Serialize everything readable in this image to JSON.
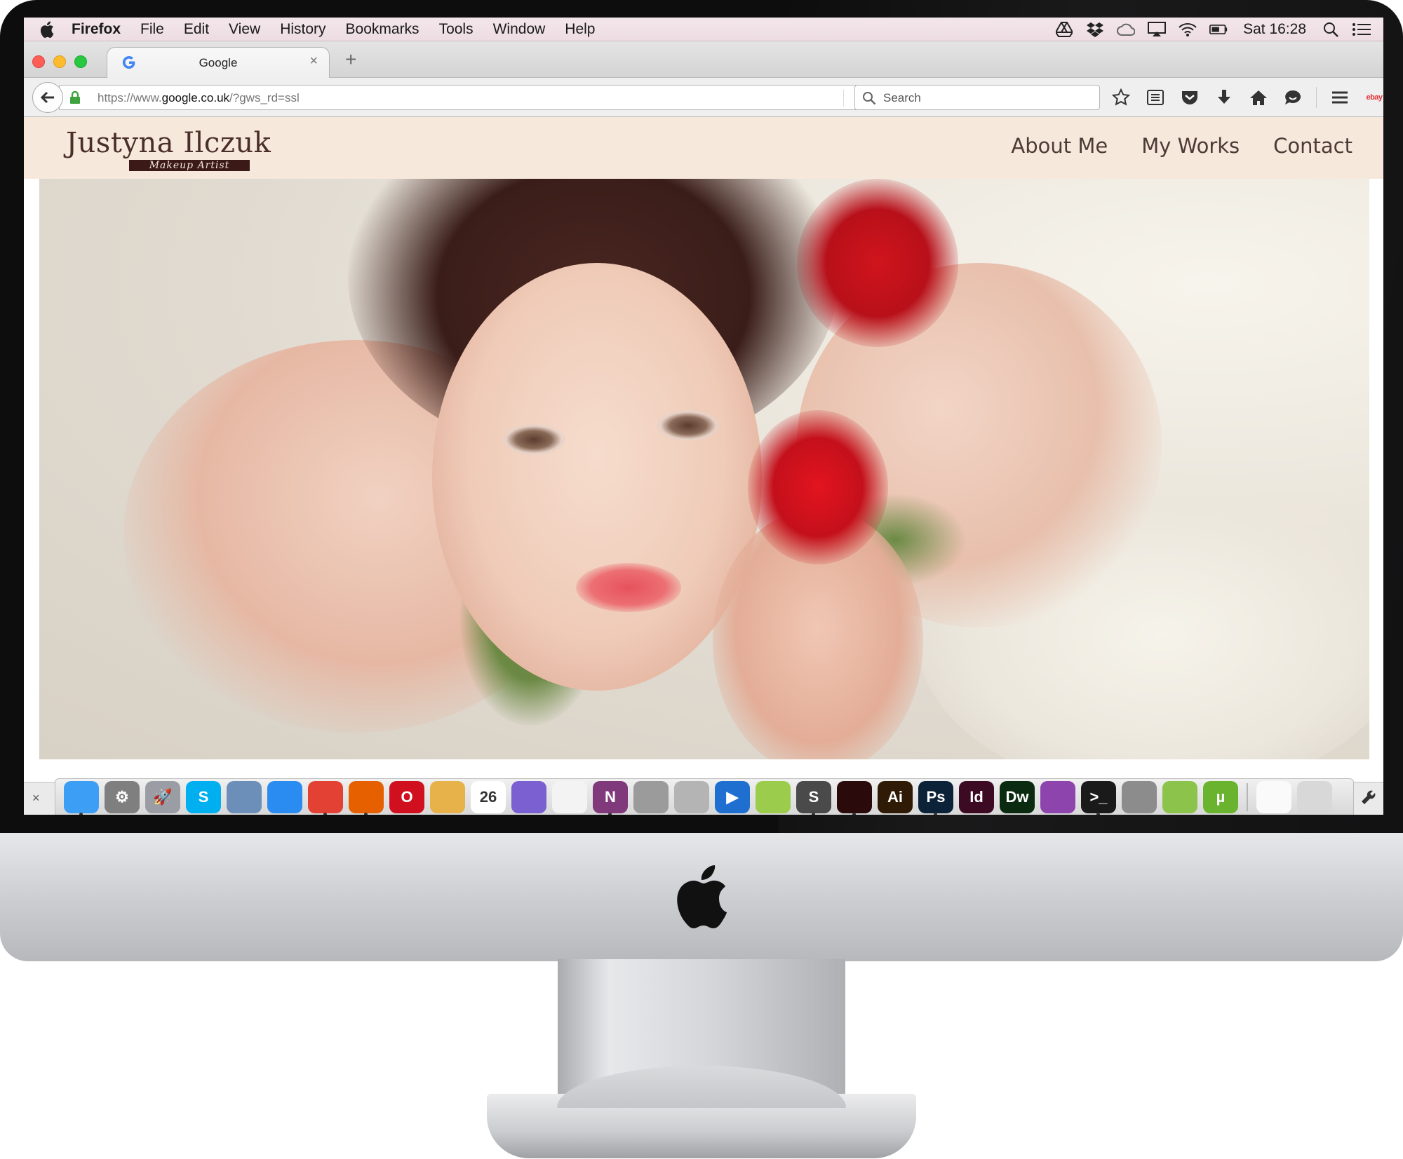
{
  "menubar": {
    "app_name": "Firefox",
    "menus": [
      "File",
      "Edit",
      "View",
      "History",
      "Bookmarks",
      "Tools",
      "Window",
      "Help"
    ],
    "clock": "Sat 16:28"
  },
  "browser": {
    "tab_title": "Google",
    "tab_close": "×",
    "new_tab": "+",
    "url_prefix": "https://www.",
    "url_host": "google.co.uk",
    "url_suffix": "/?gws_rd=ssl",
    "search_placeholder": "Search",
    "ebay": "ebay"
  },
  "site": {
    "logo_name": "Justyna Ilczuk",
    "logo_tagline": "Makeup Artist",
    "nav": [
      "About Me",
      "My Works",
      "Contact"
    ],
    "colors": {
      "header_bg": "#f7e8dc",
      "nav_text": "#4d3a35",
      "tagline_bg": "#3a1916"
    }
  },
  "dock": {
    "close": "×",
    "items": [
      {
        "name": "finder",
        "label": "",
        "bg": "#3d9ef5",
        "running": true
      },
      {
        "name": "system-preferences",
        "label": "⚙",
        "bg": "#7f7f7f",
        "running": false
      },
      {
        "name": "launchpad",
        "label": "🚀",
        "bg": "#9a9ea4",
        "running": false
      },
      {
        "name": "skype",
        "label": "S",
        "bg": "#00aff0",
        "running": false
      },
      {
        "name": "preview",
        "label": "",
        "bg": "#6b8fb8",
        "running": false
      },
      {
        "name": "safari",
        "label": "",
        "bg": "#2a8cf0",
        "running": false
      },
      {
        "name": "chrome",
        "label": "",
        "bg": "#e34133",
        "running": true
      },
      {
        "name": "firefox",
        "label": "",
        "bg": "#e66000",
        "running": true
      },
      {
        "name": "opera",
        "label": "O",
        "bg": "#d0101f",
        "running": false
      },
      {
        "name": "migration",
        "label": "",
        "bg": "#e7b24a",
        "running": false
      },
      {
        "name": "calendar",
        "label": "26",
        "bg": "#ffffff",
        "running": false
      },
      {
        "name": "spaces",
        "label": "",
        "bg": "#7a60d0",
        "running": false
      },
      {
        "name": "textedit",
        "label": "",
        "bg": "#f3f3f3",
        "running": false
      },
      {
        "name": "onenote",
        "label": "N",
        "bg": "#80397b",
        "running": true
      },
      {
        "name": "calculator",
        "label": "",
        "bg": "#9b9b9b",
        "running": false
      },
      {
        "name": "disk-utility",
        "label": "",
        "bg": "#b4b4b4",
        "running": false
      },
      {
        "name": "quicktime",
        "label": "▶",
        "bg": "#1e6fd0",
        "running": false
      },
      {
        "name": "iphoto",
        "label": "",
        "bg": "#9ccc4b",
        "running": false
      },
      {
        "name": "sublime",
        "label": "S",
        "bg": "#4a4a4a",
        "running": true
      },
      {
        "name": "acrobat",
        "label": "",
        "bg": "#2a0a0a",
        "running": true
      },
      {
        "name": "illustrator",
        "label": "Ai",
        "bg": "#2f1b05",
        "running": false
      },
      {
        "name": "photoshop",
        "label": "Ps",
        "bg": "#0c2238",
        "running": true
      },
      {
        "name": "indesign",
        "label": "Id",
        "bg": "#3d0a24",
        "running": false
      },
      {
        "name": "dreamweaver",
        "label": "Dw",
        "bg": "#0b2b10",
        "running": false
      },
      {
        "name": "github",
        "label": "",
        "bg": "#8e44ad",
        "running": false
      },
      {
        "name": "terminal",
        "label": ">_",
        "bg": "#1a1a1a",
        "running": true
      },
      {
        "name": "koala",
        "label": "",
        "bg": "#8c8c8c",
        "running": false
      },
      {
        "name": "android",
        "label": "",
        "bg": "#8cc34a",
        "running": false
      },
      {
        "name": "utorrent",
        "label": "µ",
        "bg": "#69b32e",
        "running": false
      }
    ],
    "trailing": [
      {
        "name": "document",
        "label": "",
        "bg": "#fafafa"
      },
      {
        "name": "trash",
        "label": "",
        "bg": "#d8d8d8"
      }
    ]
  }
}
